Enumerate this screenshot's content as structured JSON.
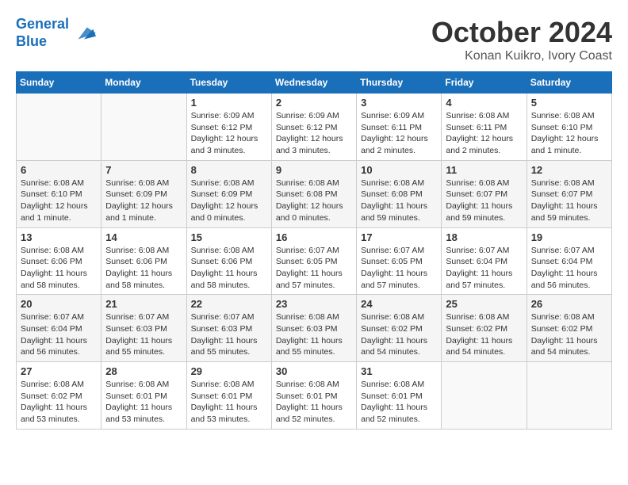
{
  "header": {
    "logo_line1": "General",
    "logo_line2": "Blue",
    "month_title": "October 2024",
    "location": "Konan Kuikro, Ivory Coast"
  },
  "weekdays": [
    "Sunday",
    "Monday",
    "Tuesday",
    "Wednesday",
    "Thursday",
    "Friday",
    "Saturday"
  ],
  "weeks": [
    [
      {
        "day": "",
        "info": ""
      },
      {
        "day": "",
        "info": ""
      },
      {
        "day": "1",
        "info": "Sunrise: 6:09 AM\nSunset: 6:12 PM\nDaylight: 12 hours and 3 minutes."
      },
      {
        "day": "2",
        "info": "Sunrise: 6:09 AM\nSunset: 6:12 PM\nDaylight: 12 hours and 3 minutes."
      },
      {
        "day": "3",
        "info": "Sunrise: 6:09 AM\nSunset: 6:11 PM\nDaylight: 12 hours and 2 minutes."
      },
      {
        "day": "4",
        "info": "Sunrise: 6:08 AM\nSunset: 6:11 PM\nDaylight: 12 hours and 2 minutes."
      },
      {
        "day": "5",
        "info": "Sunrise: 6:08 AM\nSunset: 6:10 PM\nDaylight: 12 hours and 1 minute."
      }
    ],
    [
      {
        "day": "6",
        "info": "Sunrise: 6:08 AM\nSunset: 6:10 PM\nDaylight: 12 hours and 1 minute."
      },
      {
        "day": "7",
        "info": "Sunrise: 6:08 AM\nSunset: 6:09 PM\nDaylight: 12 hours and 1 minute."
      },
      {
        "day": "8",
        "info": "Sunrise: 6:08 AM\nSunset: 6:09 PM\nDaylight: 12 hours and 0 minutes."
      },
      {
        "day": "9",
        "info": "Sunrise: 6:08 AM\nSunset: 6:08 PM\nDaylight: 12 hours and 0 minutes."
      },
      {
        "day": "10",
        "info": "Sunrise: 6:08 AM\nSunset: 6:08 PM\nDaylight: 11 hours and 59 minutes."
      },
      {
        "day": "11",
        "info": "Sunrise: 6:08 AM\nSunset: 6:07 PM\nDaylight: 11 hours and 59 minutes."
      },
      {
        "day": "12",
        "info": "Sunrise: 6:08 AM\nSunset: 6:07 PM\nDaylight: 11 hours and 59 minutes."
      }
    ],
    [
      {
        "day": "13",
        "info": "Sunrise: 6:08 AM\nSunset: 6:06 PM\nDaylight: 11 hours and 58 minutes."
      },
      {
        "day": "14",
        "info": "Sunrise: 6:08 AM\nSunset: 6:06 PM\nDaylight: 11 hours and 58 minutes."
      },
      {
        "day": "15",
        "info": "Sunrise: 6:08 AM\nSunset: 6:06 PM\nDaylight: 11 hours and 58 minutes."
      },
      {
        "day": "16",
        "info": "Sunrise: 6:07 AM\nSunset: 6:05 PM\nDaylight: 11 hours and 57 minutes."
      },
      {
        "day": "17",
        "info": "Sunrise: 6:07 AM\nSunset: 6:05 PM\nDaylight: 11 hours and 57 minutes."
      },
      {
        "day": "18",
        "info": "Sunrise: 6:07 AM\nSunset: 6:04 PM\nDaylight: 11 hours and 57 minutes."
      },
      {
        "day": "19",
        "info": "Sunrise: 6:07 AM\nSunset: 6:04 PM\nDaylight: 11 hours and 56 minutes."
      }
    ],
    [
      {
        "day": "20",
        "info": "Sunrise: 6:07 AM\nSunset: 6:04 PM\nDaylight: 11 hours and 56 minutes."
      },
      {
        "day": "21",
        "info": "Sunrise: 6:07 AM\nSunset: 6:03 PM\nDaylight: 11 hours and 55 minutes."
      },
      {
        "day": "22",
        "info": "Sunrise: 6:07 AM\nSunset: 6:03 PM\nDaylight: 11 hours and 55 minutes."
      },
      {
        "day": "23",
        "info": "Sunrise: 6:08 AM\nSunset: 6:03 PM\nDaylight: 11 hours and 55 minutes."
      },
      {
        "day": "24",
        "info": "Sunrise: 6:08 AM\nSunset: 6:02 PM\nDaylight: 11 hours and 54 minutes."
      },
      {
        "day": "25",
        "info": "Sunrise: 6:08 AM\nSunset: 6:02 PM\nDaylight: 11 hours and 54 minutes."
      },
      {
        "day": "26",
        "info": "Sunrise: 6:08 AM\nSunset: 6:02 PM\nDaylight: 11 hours and 54 minutes."
      }
    ],
    [
      {
        "day": "27",
        "info": "Sunrise: 6:08 AM\nSunset: 6:02 PM\nDaylight: 11 hours and 53 minutes."
      },
      {
        "day": "28",
        "info": "Sunrise: 6:08 AM\nSunset: 6:01 PM\nDaylight: 11 hours and 53 minutes."
      },
      {
        "day": "29",
        "info": "Sunrise: 6:08 AM\nSunset: 6:01 PM\nDaylight: 11 hours and 53 minutes."
      },
      {
        "day": "30",
        "info": "Sunrise: 6:08 AM\nSunset: 6:01 PM\nDaylight: 11 hours and 52 minutes."
      },
      {
        "day": "31",
        "info": "Sunrise: 6:08 AM\nSunset: 6:01 PM\nDaylight: 11 hours and 52 minutes."
      },
      {
        "day": "",
        "info": ""
      },
      {
        "day": "",
        "info": ""
      }
    ]
  ]
}
